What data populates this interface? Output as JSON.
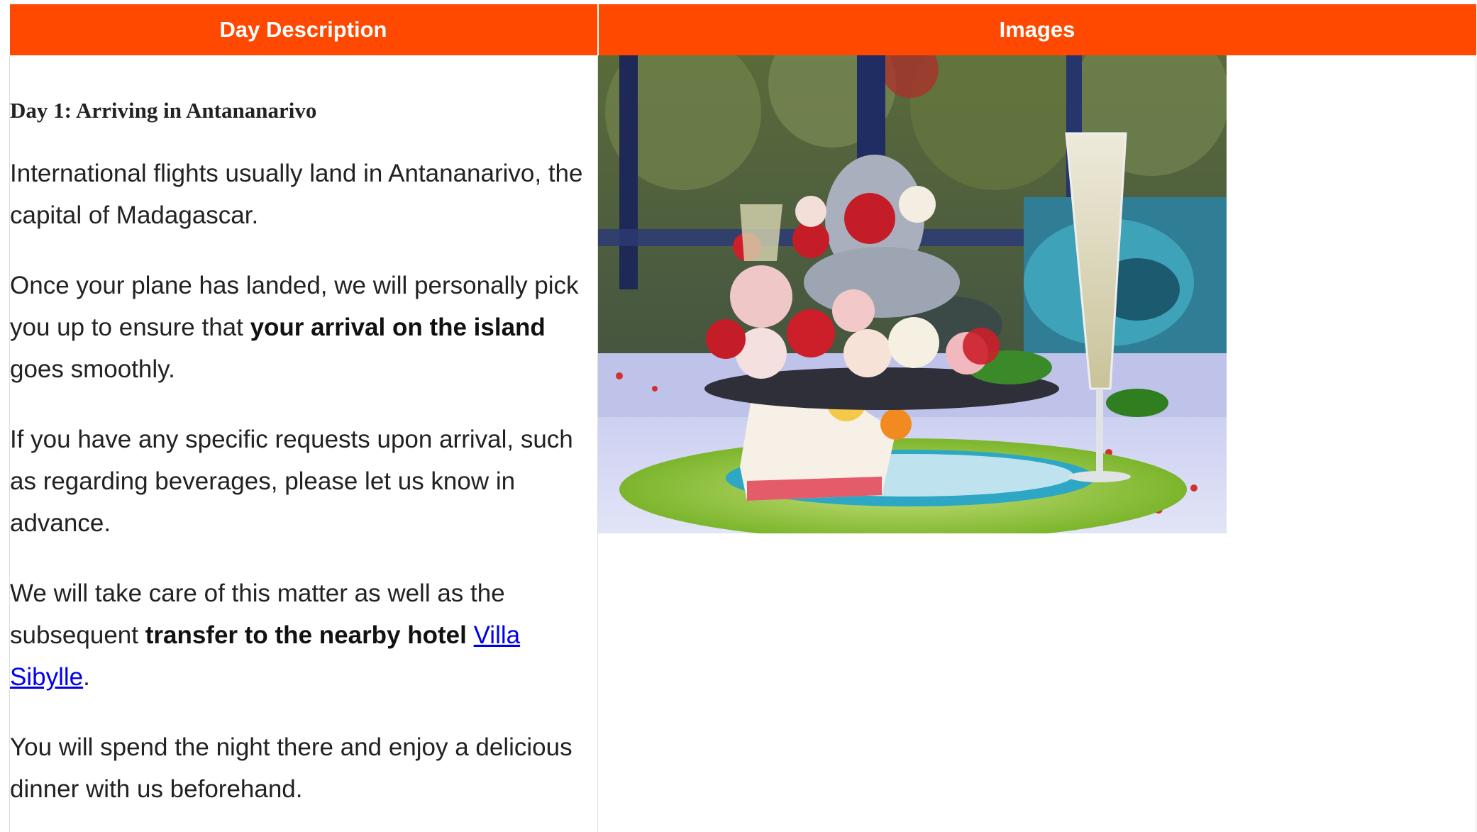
{
  "table": {
    "headers": [
      "Day Description",
      "Images"
    ],
    "header_color": "#ff4800"
  },
  "day": {
    "title": "Day 1: Arriving in Antananarivo",
    "p1": "International flights usually land in Antananarivo, the capital of Madagascar.",
    "p2_before": "Once your plane has landed, we will personally pick you up to ensure that ",
    "p2_bold": "your arrival on the island",
    "p2_after": " goes smoothly.",
    "p3": "If you have any specific requests upon arrival, such as regarding beverages, please let us know in advance.",
    "p4_before": "We will take care of this matter as well as the subsequent ",
    "p4_bold": "transfer to the nearby hotel",
    "p4_space": " ",
    "p4_link": "Villa Sibylle",
    "p4_after": ".",
    "p5": "You will spend the night there and enjoy a delicious dinner with us beforehand."
  },
  "image": {
    "subject": "table-setting-photo"
  }
}
